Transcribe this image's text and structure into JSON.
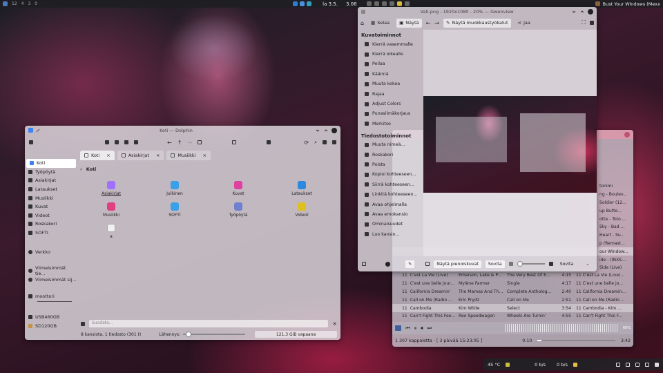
{
  "top_panel": {
    "clock_date": "la 3.5.",
    "clock_time": "3.06",
    "left_items": [
      "12",
      "4",
      "3",
      "0"
    ],
    "active_window": "Bust Your Windows (Mexx"
  },
  "dolphin": {
    "title": "Koti — Dolphin",
    "tabs": [
      "Koti",
      "Asiakirjat",
      "Musiikki"
    ],
    "breadcrumb": "Koti",
    "sidebar": [
      {
        "label": "Koti",
        "active": true
      },
      {
        "label": "Työpöytä"
      },
      {
        "label": "Asiakirjat"
      },
      {
        "label": "Lataukset"
      },
      {
        "label": "Musiikki"
      },
      {
        "label": "Kuvat"
      },
      {
        "label": "Videot"
      },
      {
        "label": "Roskakori"
      },
      {
        "label": "SOFTI"
      }
    ],
    "sidebar_network": "Verkko",
    "sidebar_recent": [
      "Viimeisimmät tie...",
      "Viimeisimmät sij..."
    ],
    "sidebar_devices": [
      "moottori"
    ],
    "sidebar_removable": [
      "USB460GB",
      "SD120GB"
    ],
    "files": [
      {
        "name": "Asiakirjat",
        "color": "#a070ff"
      },
      {
        "name": "Julkinen",
        "color": "#3aa0e8"
      },
      {
        "name": "Kuvat",
        "color": "#e040a0"
      },
      {
        "name": "Lataukset",
        "color": "#2a8ae0"
      },
      {
        "name": "Musiikki",
        "color": "#e04080"
      },
      {
        "name": "SOFTI",
        "color": "#3aa0e8"
      },
      {
        "name": "Työpöytä",
        "color": "#7080d0"
      },
      {
        "name": "Videot",
        "color": "#e0c020"
      },
      {
        "name": "a",
        "color": "#f0f0f0"
      }
    ],
    "filter_placeholder": "Suodata...",
    "status_count": "8 kansiota, 1 tiedosto (301 t)",
    "zoom_label": "Lähennys:",
    "free_space": "121,3 GiB vapaana"
  },
  "gwenview": {
    "title": "Vati.png - 1920x1080 - 20% — Gwenview",
    "toolbar": {
      "browse": "Selaa",
      "view": "Näytä",
      "editor": "Näytä muokkaustyökalut",
      "share": "Jaa"
    },
    "image_actions_title": "Kuvatoiminnot",
    "image_actions": [
      "Kierrä vasemmalle",
      "Kierrä oikealle",
      "Peilaa",
      "Käännä",
      "Muuta kokoa",
      "Rajaa",
      "Adjust Colors",
      "Punasilmäkorjaus",
      "Merkitse"
    ],
    "file_actions_title": "Tiedostotoiminnot",
    "file_actions": [
      "Muuta nimeä...",
      "Roskakori",
      "Poista",
      "Kopioi kohteeseen...",
      "Siirrä kohteeseen...",
      "Linkitä kohteeseen...",
      "Avaa ohjelmalla",
      "Avaa emokansio",
      "Ominaisuudet",
      "Luo kansio..."
    ],
    "thumbnails_button": "Näytä pienoiskuvat",
    "fit_button": "Sovita",
    "fit_select": "Sovita"
  },
  "music": {
    "partial_rows": [
      {
        "c5": "tonimi"
      },
      {
        "c5": "ng - Boulev..."
      },
      {
        "c5": "Soldier (12..."
      },
      {
        "c5": "up Butte..."
      },
      {
        "c5": "otte - Toto ..."
      },
      {
        "c5": "Sky - Bad ..."
      },
      {
        "c5": "Heart - Su..."
      },
      {
        "c5": "p (Remast..."
      },
      {
        "c5": "our Window..."
      },
      {
        "c5": "ide - (INXS..."
      },
      {
        "c5": "Side (Live)"
      }
    ],
    "rows": [
      {
        "n": "11",
        "title": "C'est La Vie (Live)",
        "artist": "Emerson, Lake & Pal...",
        "album": "The Very Best Of Em...",
        "time": "4:15",
        "c5": "11 C'est La Vie (Live)..."
      },
      {
        "n": "11",
        "title": "C'est une belle journ...",
        "artist": "Mylène Farmer",
        "album": "Single",
        "time": "4:17",
        "c5": "11 C'est une belle jo..."
      },
      {
        "n": "11",
        "title": "California Dreamin'",
        "artist": "The Mamas And The ...",
        "album": "Complete Anthology ...",
        "time": "2:40",
        "c5": "11 California Dreamin..."
      },
      {
        "n": "11",
        "title": "Call on Me (Radio Mi...",
        "artist": "Eric Prydz",
        "album": "Call on Me",
        "time": "2:51",
        "c5": "11 Call on Me (Radio ..."
      },
      {
        "n": "11",
        "title": "Cambodia",
        "artist": "Kim Wilde",
        "album": "Select",
        "time": "3:54",
        "c5": "11 Cambodia - Kim ..."
      },
      {
        "n": "11",
        "title": "Can't Fight This Feeli...",
        "artist": "Reo Speedwagon",
        "album": "Wheels Are Turnin'",
        "time": "4:55",
        "c5": "11 Can't Fight This F..."
      }
    ],
    "status": "1 307 kappaletta - [ 3 päivää 15:23:05 ]",
    "elapsed": "0:10",
    "total": "3:42",
    "progress_fraction": 0.05,
    "volume_label": "60%"
  },
  "bottom_panel": {
    "temp": "45 °C",
    "net_down": "0 b/s",
    "net_up": "0 b/s"
  },
  "colors": {
    "accent": "#3b82f6",
    "window_bg": "#e1dce2"
  }
}
